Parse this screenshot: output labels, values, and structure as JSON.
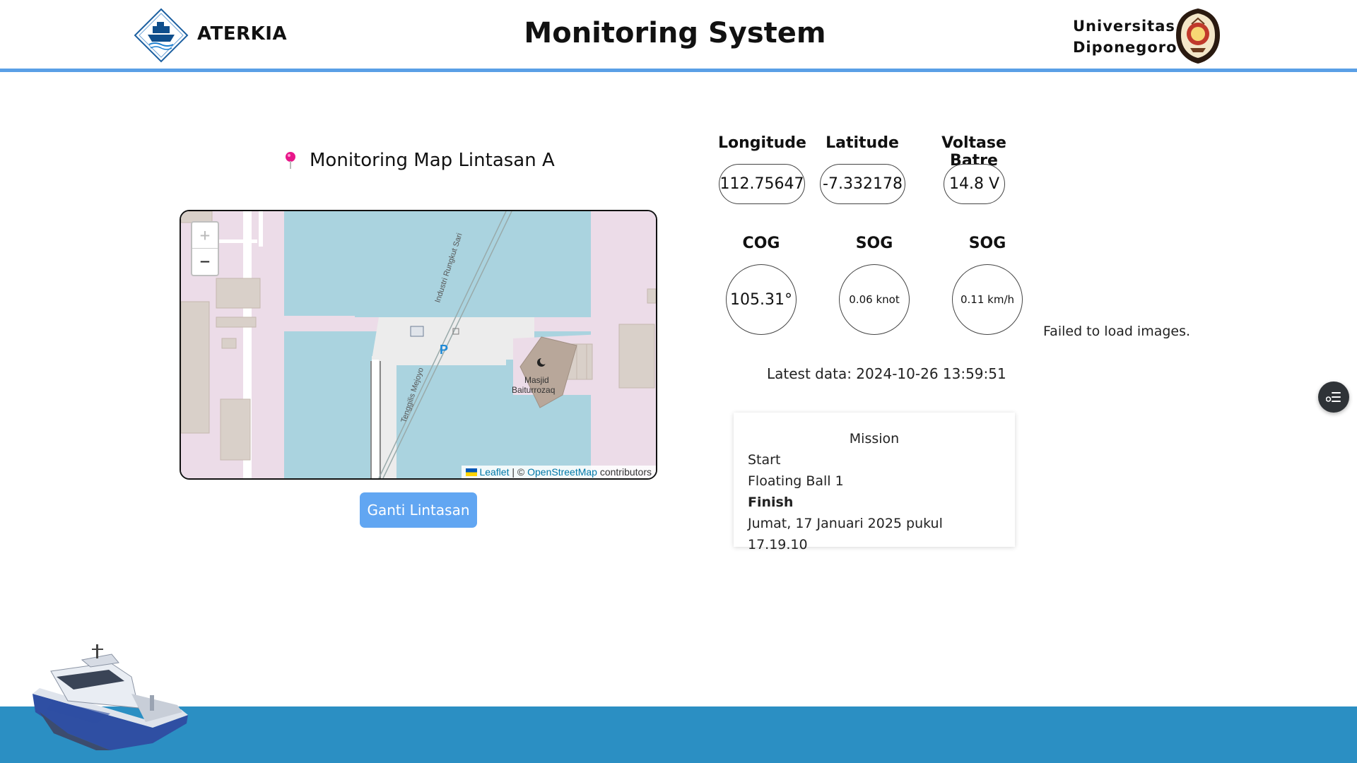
{
  "header": {
    "brand": "ATERKIA",
    "title": "Monitoring System",
    "university_line1": "Universitas",
    "university_line2": "Diponegoro"
  },
  "map": {
    "heading": "Monitoring Map Lintasan A",
    "zoom_in": "+",
    "zoom_out": "−",
    "labels": {
      "road1": "Industri Rungkut Sari",
      "road2": "Tenggilis Mejoyo",
      "poi_line1": "Masjid",
      "poi_line2": "Baiturrozaq",
      "parking": "P"
    },
    "attribution": {
      "leaflet": "Leaflet",
      "separator": " | © ",
      "osm": "OpenStreetMap",
      "suffix": " contributors"
    },
    "button": "Ganti Lintasan"
  },
  "telemetry": {
    "longitude_label": "Longitude",
    "longitude_value": "112.75647",
    "latitude_label": "Latitude",
    "latitude_value": "-7.332178",
    "battery_label": "Voltase Batre",
    "battery_value": "14.8 V",
    "cog_label": "COG",
    "cog_value": "105.31°",
    "sog_knot_label": "SOG",
    "sog_knot_value": "0.06 knot",
    "sog_kmh_label": "SOG",
    "sog_kmh_value": "0.11 km/h",
    "images_status": "Failed to load images.",
    "latest_data": "Latest data: 2024-10-26 13:59:51"
  },
  "mission": {
    "title": "Mission",
    "items": [
      "Start",
      "Floating Ball 1"
    ],
    "finish_label": "Finish",
    "finish_time": "Jumat, 17 Januari 2025 pukul 17.19.10"
  },
  "colors": {
    "header_rule": "#5a9fe6",
    "button": "#61a6f2",
    "footer": "#2b8fc3",
    "water": "#aad3df",
    "land": "#ecdce8",
    "pin": "#e8178a"
  },
  "icons": {
    "map_pin": "map-pin-icon",
    "floating_button": "list-settings-icon"
  }
}
